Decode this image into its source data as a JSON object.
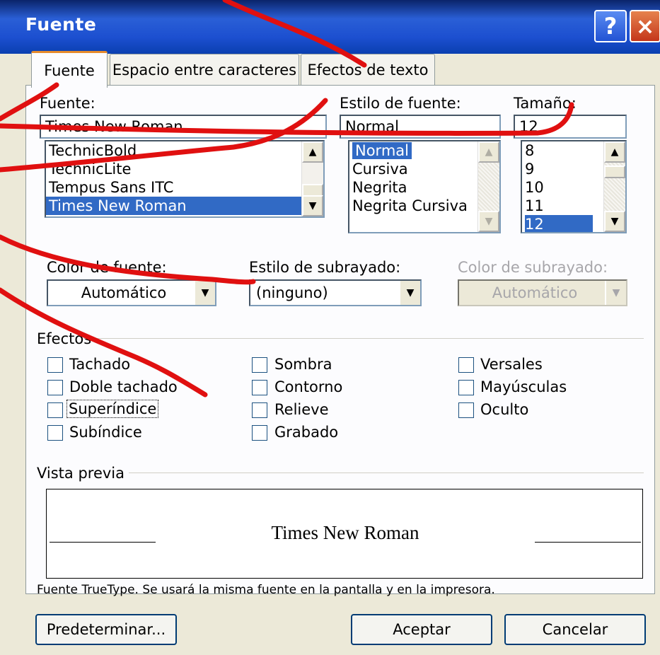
{
  "window": {
    "title": "Fuente",
    "help_label": "?",
    "close_label": "×"
  },
  "tabs": [
    {
      "label": "Fuente",
      "active": true
    },
    {
      "label": "Espacio entre caracteres",
      "active": false
    },
    {
      "label": "Efectos de texto",
      "active": false
    }
  ],
  "font": {
    "label": "Fuente:",
    "value": "Times New Roman",
    "items": [
      "TechnicBold",
      "TechnicLite",
      "Tempus Sans ITC",
      "Times New Roman"
    ],
    "selected": "Times New Roman"
  },
  "style": {
    "label": "Estilo de fuente:",
    "value": "Normal",
    "items": [
      "Normal",
      "Cursiva",
      "Negrita",
      "Negrita Cursiva"
    ],
    "selected": "Normal"
  },
  "size": {
    "label": "Tamaño:",
    "value": "12",
    "items": [
      "8",
      "9",
      "10",
      "11",
      "12"
    ],
    "selected": "12"
  },
  "font_color": {
    "label": "Color de fuente:",
    "value": "Automático"
  },
  "underline_style": {
    "label": "Estilo de subrayado:",
    "value": "(ninguno)"
  },
  "underline_color": {
    "label": "Color de subrayado:",
    "value": "Automático"
  },
  "effects": {
    "label": "Efectos",
    "col1": [
      "Tachado",
      "Doble tachado",
      "Superíndice",
      "Subíndice"
    ],
    "col2": [
      "Sombra",
      "Contorno",
      "Relieve",
      "Grabado"
    ],
    "col3": [
      "Versales",
      "Mayúsculas",
      "Oculto"
    ]
  },
  "preview": {
    "label": "Vista previa",
    "sample": "Times New Roman",
    "note": "Fuente TrueType. Se usará la misma fuente en la pantalla y en la impresora."
  },
  "buttons": {
    "default": "Predeterminar...",
    "ok": "Aceptar",
    "cancel": "Cancelar"
  },
  "colors": {
    "titlebar": "#0a3fb0",
    "selection": "#316ac5",
    "annotation": "#e01010"
  }
}
